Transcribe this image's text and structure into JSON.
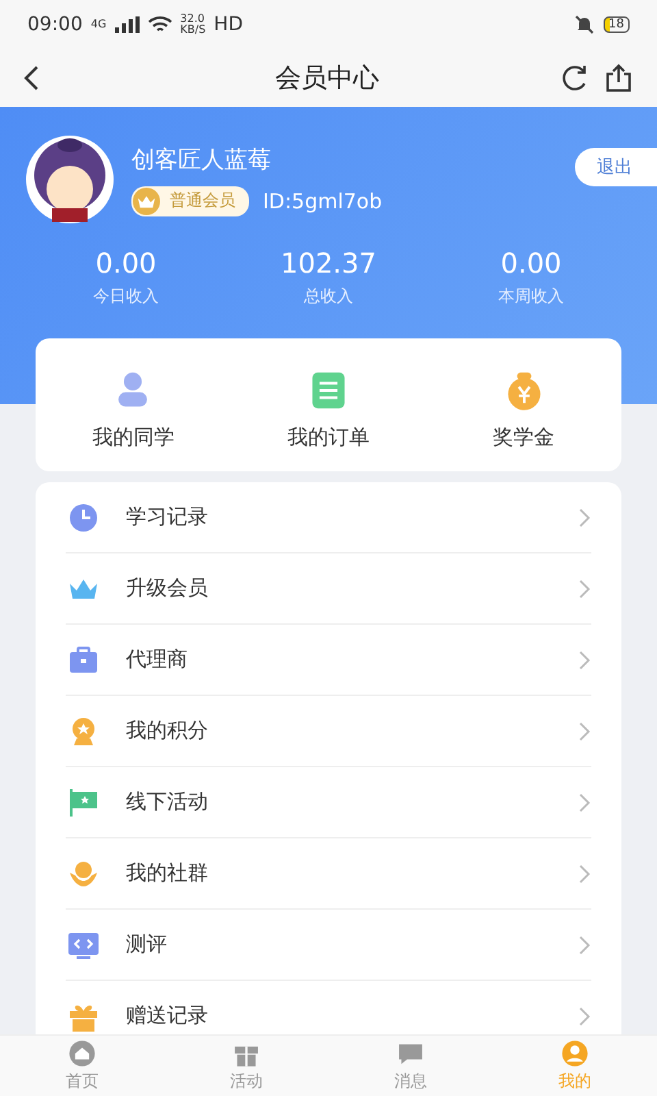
{
  "status_bar": {
    "time": "09:00",
    "network": "4G",
    "speed": "32.0",
    "speed_unit": "KB/S",
    "hd": "HD",
    "battery": "18"
  },
  "nav": {
    "title": "会员中心"
  },
  "profile": {
    "name": "创客匠人蓝莓",
    "level": "普通会员",
    "id": "ID:5gml7ob",
    "logout": "退出"
  },
  "stats": [
    {
      "value": "0.00",
      "label": "今日收入"
    },
    {
      "value": "102.37",
      "label": "总收入"
    },
    {
      "value": "0.00",
      "label": "本周收入"
    }
  ],
  "shortcuts": [
    {
      "label": "我的同学"
    },
    {
      "label": "我的订单"
    },
    {
      "label": "奖学金"
    }
  ],
  "menu": [
    {
      "label": "学习记录"
    },
    {
      "label": "升级会员"
    },
    {
      "label": "代理商"
    },
    {
      "label": "我的积分"
    },
    {
      "label": "线下活动"
    },
    {
      "label": "我的社群"
    },
    {
      "label": "测评"
    },
    {
      "label": "赠送记录"
    }
  ],
  "tab_bar": [
    {
      "label": "首页",
      "selected": false
    },
    {
      "label": "活动",
      "selected": false
    },
    {
      "label": "消息",
      "selected": false
    },
    {
      "label": "我的",
      "selected": true
    }
  ]
}
